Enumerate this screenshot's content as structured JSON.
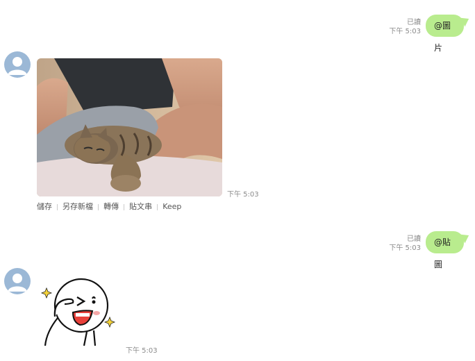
{
  "messages": {
    "sent1": {
      "read": "已讀",
      "time": "下午 5:03",
      "text": "@圖片"
    },
    "recv_image": {
      "time": "下午 5:03"
    },
    "image_actions": [
      "儲存",
      "另存新檔",
      "轉傳",
      "貼文串",
      "Keep"
    ],
    "sent2": {
      "read": "已讀",
      "time": "下午 5:03",
      "text": "@貼圖"
    },
    "recv_sticker": {
      "time": "下午 5:03"
    }
  },
  "colors": {
    "bubble": "#b9ec8e",
    "avatar": "#9bb8d6"
  }
}
